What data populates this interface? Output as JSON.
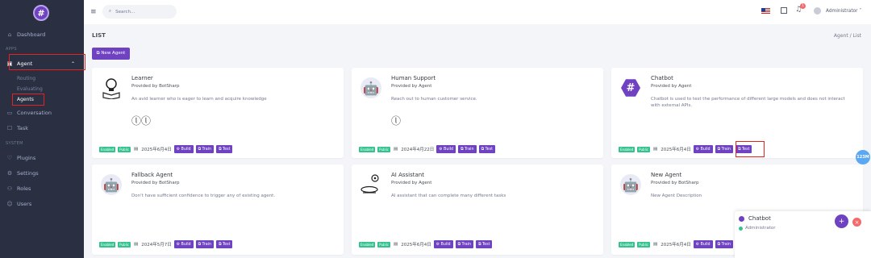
{
  "brand": {
    "glyph": "#"
  },
  "sidebar": {
    "dashboard": "Dashboard",
    "section_apps": "APPS",
    "agent": "Agent",
    "routing": "Routing",
    "evaluating": "Evaluating",
    "agents": "Agents",
    "conversation": "Conversation",
    "task": "Task",
    "section_system": "SYSTEM",
    "plugins": "Plugins",
    "settings": "Settings",
    "roles": "Roles",
    "users": "Users"
  },
  "topbar": {
    "search_placeholder": "Search...",
    "notification_count": "1",
    "user_name": "Administrator ˅"
  },
  "page": {
    "title": "LIST",
    "breadcrumb": "Agent  /  List",
    "new_agent": "⧉ New Agent"
  },
  "cards": [
    {
      "title": "Learner",
      "provider": "Provided by BotSharp",
      "desc": "An avid learner who is eager to learn and acquire knowledge",
      "util": "ⓛⓛ",
      "date": "2025年6月4日"
    },
    {
      "title": "Human Support",
      "provider": "Provided by Agent",
      "desc": "Reach out to human customer service.",
      "util": "ⓛ",
      "date": "2024年4月22日"
    },
    {
      "title": "Chatbot",
      "provider": "Provided by Agent",
      "desc": "Chatbot is used to test the performance of different large models and does not interact with external APIs.",
      "util": "",
      "date": "2025年6月4日"
    },
    {
      "title": "Fallback Agent",
      "provider": "Provided by BotSharp",
      "desc": "Don't have sufficient confidence to trigger any of existing agent.",
      "util": "",
      "date": "2024年5月7日"
    },
    {
      "title": "AI Assistant",
      "provider": "Provided by Agent",
      "desc": "AI assistant that can complete many different tasks",
      "util": "",
      "date": "2025年6月4日"
    },
    {
      "title": "New Agent",
      "provider": "Provided by BotSharp",
      "desc": "New Agent Description",
      "util": "",
      "date": "2025年6月4日"
    }
  ],
  "labels": {
    "enabled": "Enabled",
    "public": "Public",
    "build": "⚙ Build",
    "train": "⧉ Train",
    "test": "⧉ Test"
  },
  "floating": {
    "badge": "123M"
  },
  "chat": {
    "title": "Chatbot",
    "user": "Administrator",
    "add": "+",
    "close": "×"
  },
  "colors": {
    "primary": "#6f42c1",
    "sidebar": "#2a3042",
    "success": "#34c38f",
    "highlight": "#e02424"
  }
}
